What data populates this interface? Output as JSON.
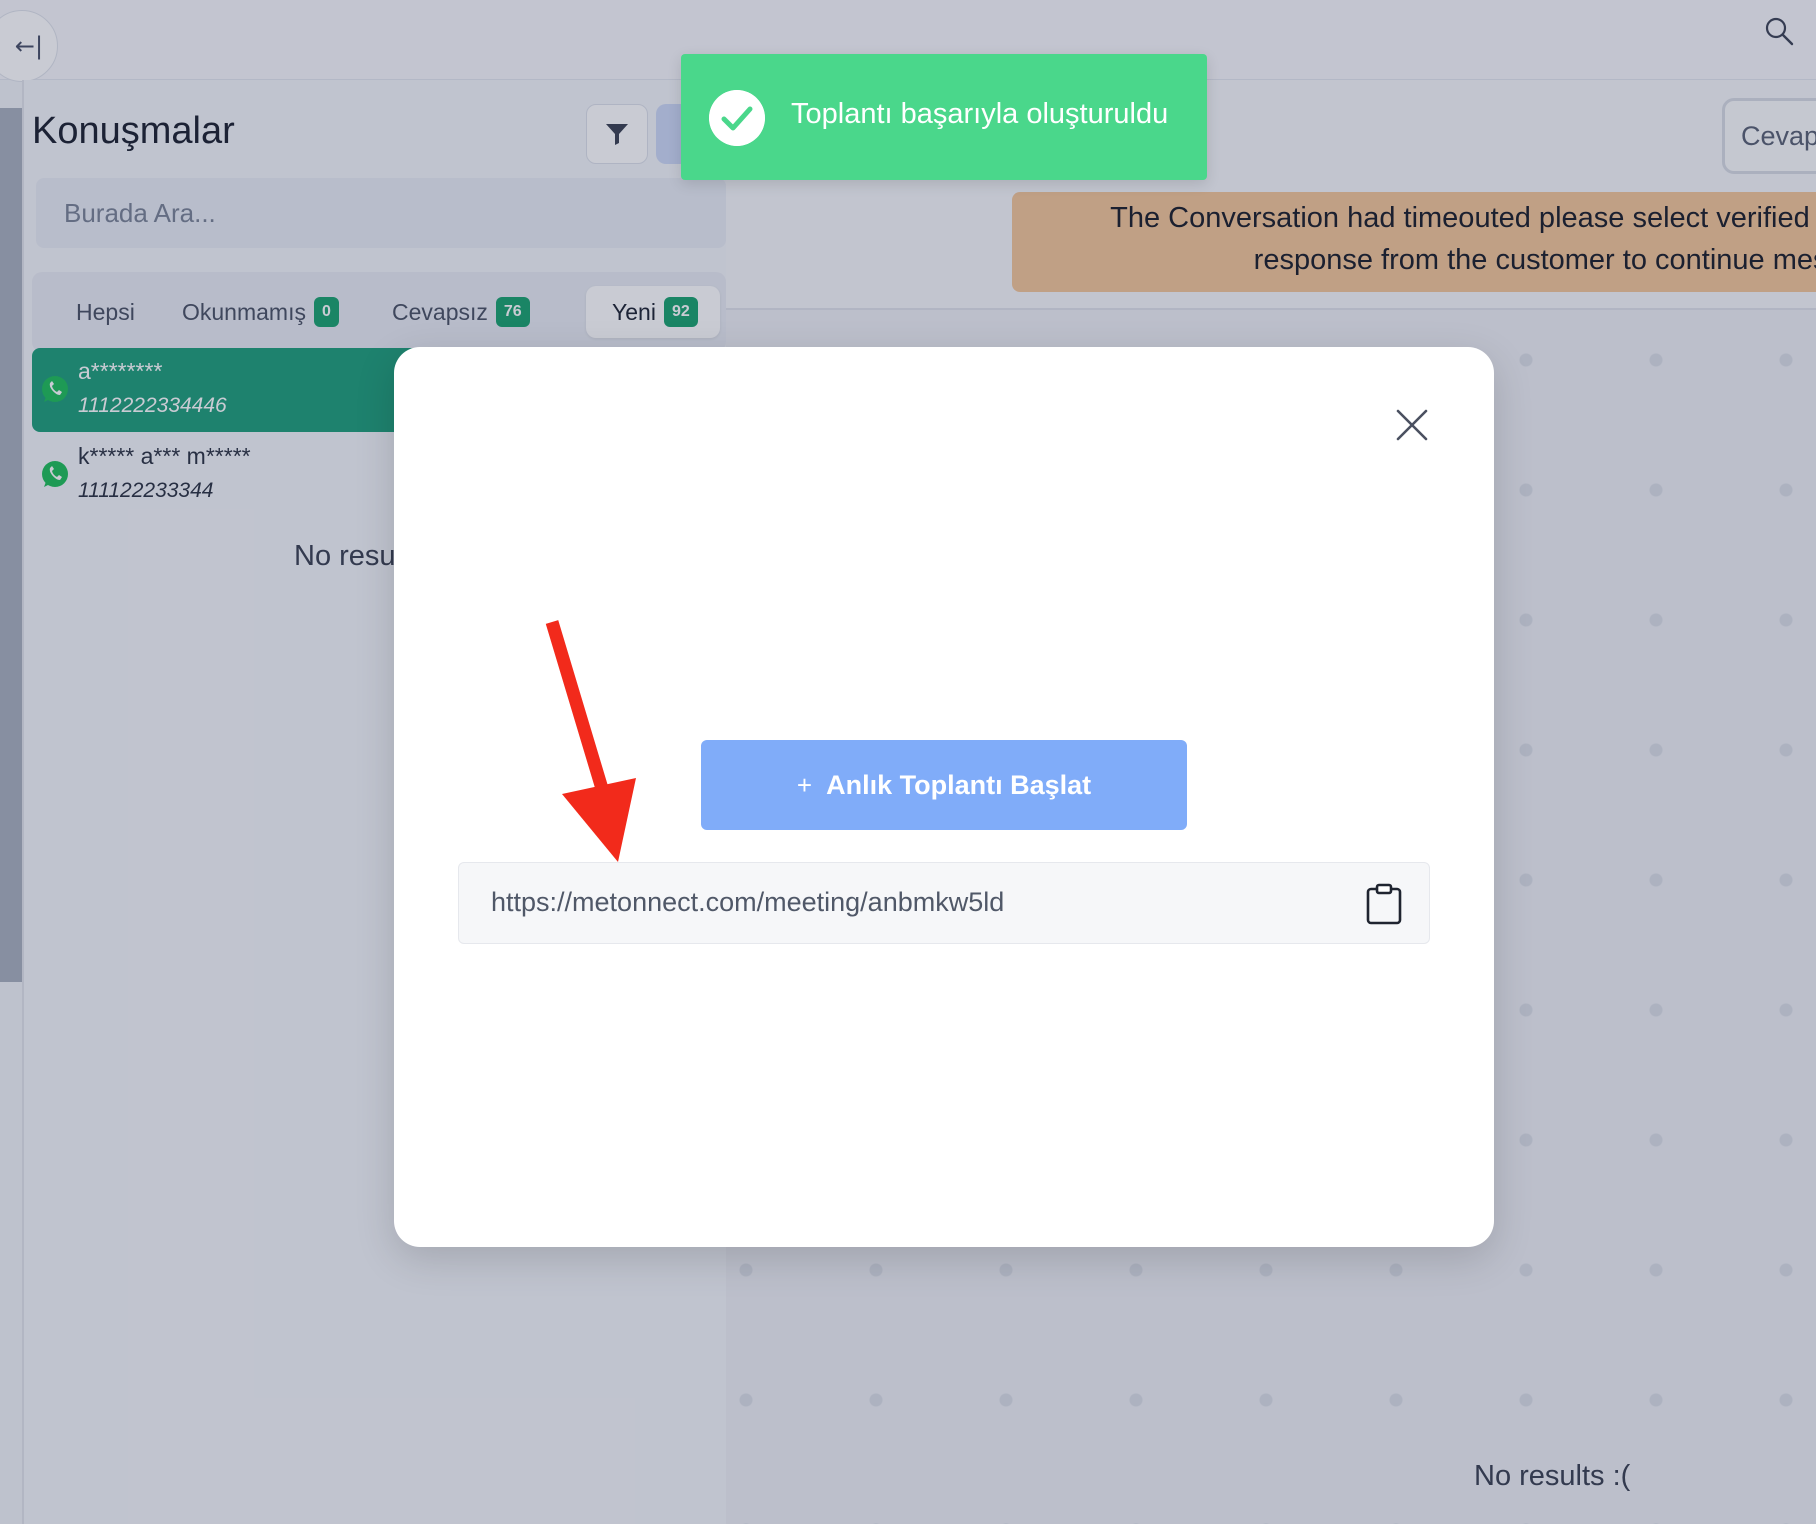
{
  "topbar": {
    "collapse_icon": "collapse-left-icon",
    "collapse_glyph": "←|",
    "search_icon": "search-icon"
  },
  "left_panel": {
    "title": "Konuşmalar",
    "filter_icon": "filter-icon",
    "search_placeholder": "Burada Ara...",
    "tabs": [
      {
        "label": "Hepsi",
        "count": null,
        "active": false
      },
      {
        "label": "Okunmamış",
        "count": "0",
        "active": false
      },
      {
        "label": "Cevapsız",
        "count": "76",
        "active": false
      },
      {
        "label": "Yeni",
        "count": "92",
        "active": true
      }
    ],
    "conversations": [
      {
        "name": "a********",
        "phone": "1112222334446",
        "selected": true,
        "icon": "whatsapp-icon"
      },
      {
        "name": "k***** a*** m*****",
        "phone": "111122233344",
        "selected": false,
        "icon": "whatsapp-icon"
      }
    ],
    "no_results": "No resu"
  },
  "right_panel": {
    "cevap_button": "Cevap",
    "timeout_line1": "The Conversation had timeouted please select verified te",
    "timeout_line2": "response from the customer to continue mess",
    "no_results": "No results :("
  },
  "toast": {
    "message": "Toplantı başarıyla oluşturuldu",
    "icon": "check-circle-icon",
    "color": "#4ad78b"
  },
  "modal": {
    "close_icon": "close-icon",
    "start_button_plus": "+",
    "start_button_label": "Anlık Toplantı Başlat",
    "meeting_link": "https://metonnect.com/meeting/anbmkw5ld",
    "copy_icon": "clipboard-icon",
    "annotation_icon": "red-arrow-annotation"
  },
  "colors": {
    "accent_green": "#1f9f7b",
    "badge_green": "#1aa36f",
    "button_blue": "#80acf9",
    "banner_orange": "#f4c799",
    "arrow_red": "#f22a1b"
  }
}
